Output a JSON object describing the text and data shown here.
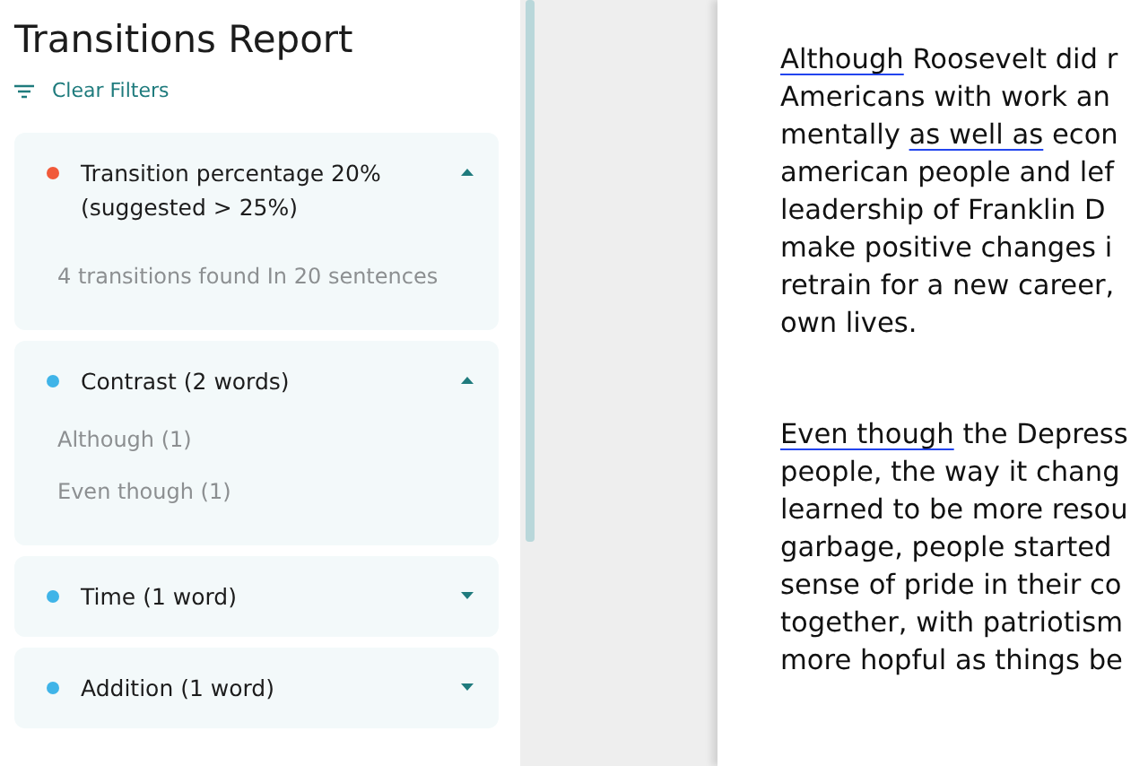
{
  "report": {
    "title": "Transitions Report",
    "clear_filters": "Clear Filters"
  },
  "groups": [
    {
      "title": "Transition percentage 20% (suggested > 25%)",
      "color": "#f15a3a",
      "expanded": true,
      "items": [
        {
          "kind": "summary",
          "text": "4 transitions found In 20 sentences"
        }
      ]
    },
    {
      "title": "Contrast (2 words)",
      "color": "#3fb4e8",
      "expanded": true,
      "items": [
        {
          "kind": "word",
          "text": "Although (1)"
        },
        {
          "kind": "word",
          "text": "Even though (1)"
        }
      ]
    },
    {
      "title": "Time (1 word)",
      "color": "#3fb4e8",
      "expanded": false
    },
    {
      "title": "Addition (1 word)",
      "color": "#3fb4e8",
      "expanded": false
    }
  ],
  "document": {
    "paragraphs": [
      [
        [
          {
            "text": "Although",
            "kind": "transition"
          },
          {
            "text": " Roosevelt did r",
            "kind": "plain"
          }
        ],
        [
          {
            "text": "Americans with work an",
            "kind": "plain"
          }
        ],
        [
          {
            "text": "mentally ",
            "kind": "plain"
          },
          {
            "text": "as well as",
            "kind": "transition"
          },
          {
            "text": " econ",
            "kind": "plain"
          }
        ],
        [
          {
            "text": "american people and lef",
            "kind": "plain"
          }
        ],
        [
          {
            "text": "leadership of Franklin D",
            "kind": "plain"
          }
        ],
        [
          {
            "text": "make positive changes i",
            "kind": "plain"
          }
        ],
        [
          {
            "text": "retrain for a new career,",
            "kind": "plain"
          }
        ],
        [
          {
            "text": "own lives.",
            "kind": "plain"
          }
        ]
      ],
      [
        [
          {
            "text": "Even though",
            "kind": "transition"
          },
          {
            "text": " the Depress",
            "kind": "plain"
          }
        ],
        [
          {
            "text": "people, the way it chang",
            "kind": "plain"
          }
        ],
        [
          {
            "text": "learned to be more resou",
            "kind": "plain"
          }
        ],
        [
          {
            "text": "garbage, people started",
            "kind": "plain"
          }
        ],
        [
          {
            "text": "sense of pride in their co",
            "kind": "plain"
          }
        ],
        [
          {
            "text": "together, with patriotism",
            "kind": "plain"
          }
        ],
        [
          {
            "text": "more hopful as things be",
            "kind": "plain"
          }
        ]
      ]
    ]
  }
}
